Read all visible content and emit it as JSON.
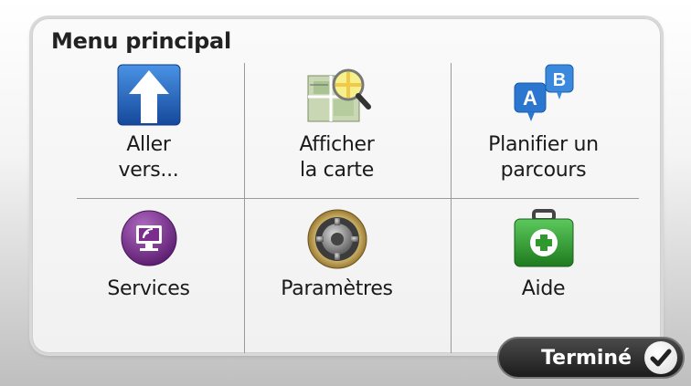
{
  "menu": {
    "title": "Menu principal",
    "items": [
      {
        "label": "Aller\nvers...",
        "icon": "arrow-up-icon"
      },
      {
        "label": "Afficher\nla carte",
        "icon": "map-magnifier-icon"
      },
      {
        "label": "Planifier un\nparcours",
        "icon": "route-ab-icon"
      },
      {
        "label": "Services",
        "icon": "monitor-wireless-icon"
      },
      {
        "label": "Paramètres",
        "icon": "gear-icon"
      },
      {
        "label": "Aide",
        "icon": "first-aid-kit-icon"
      }
    ]
  },
  "footer": {
    "done_label": "Terminé",
    "done_icon": "checkmark-icon"
  },
  "colors": {
    "arrow_blue": "#1d5fb4",
    "route_blue": "#2f7fd6",
    "services_purple": "#7a2d8c",
    "help_green": "#2e9a2e",
    "done_dark": "#1c1c1c"
  }
}
